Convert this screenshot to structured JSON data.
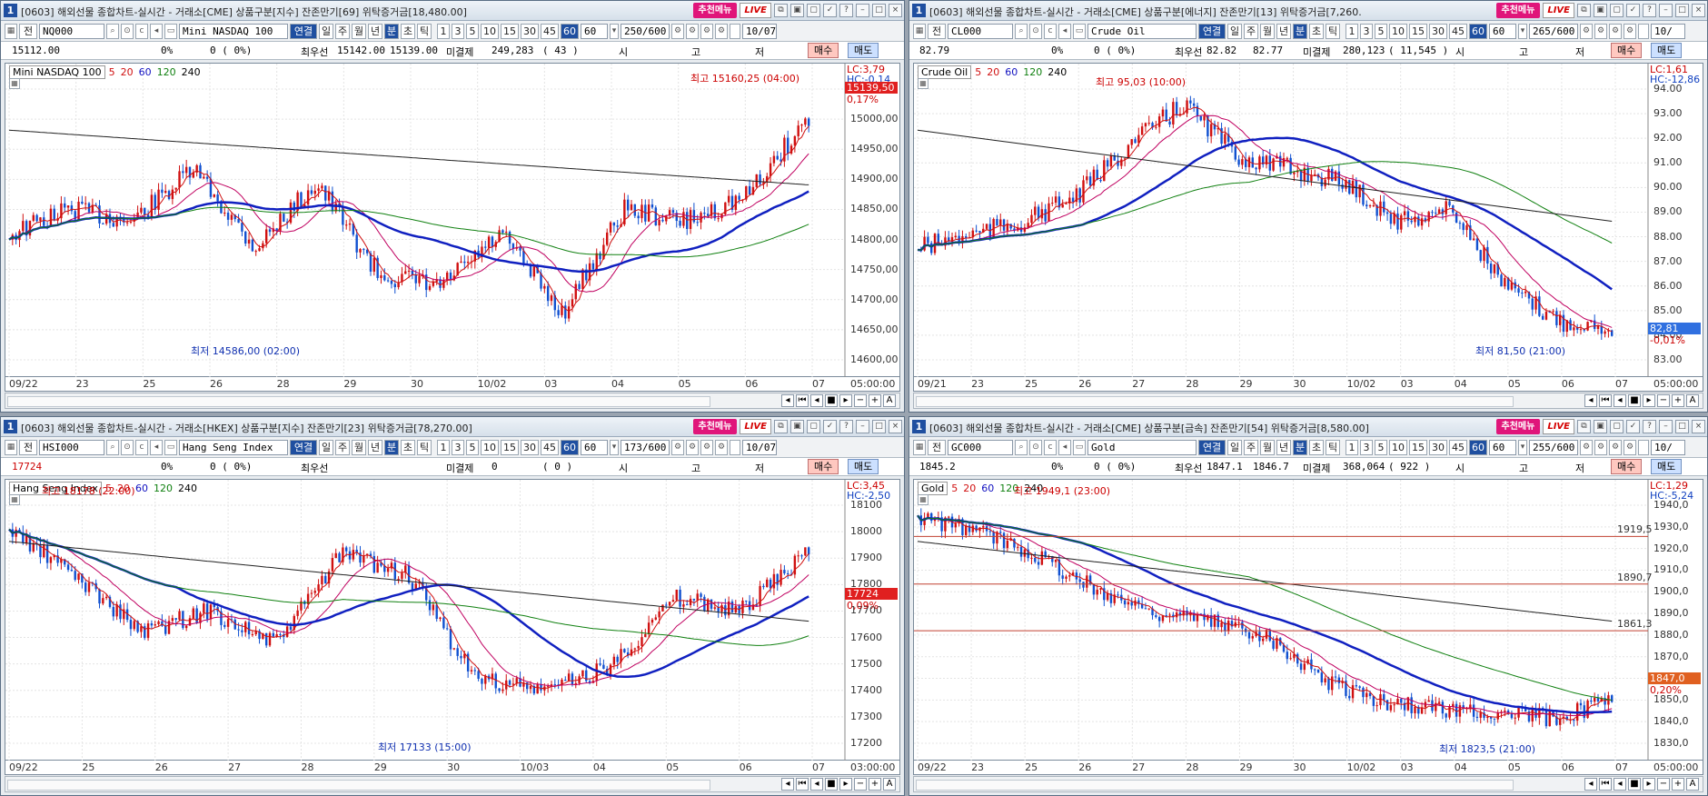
{
  "panels": [
    {
      "title": "[0603] 해외선물 종합차트-실시간 - 거래소[CME] 상품구분[지수] 잔존만기[69] 위탁증거금[18,480.00]",
      "code": "NQ000",
      "name": "Mini NASDAQ 100",
      "count": "250/600",
      "date": "10/07",
      "info": {
        "price": "15112.00",
        "rate": "0%",
        "diff": "0 (   0%)",
        "best_label": "최우선",
        "best_bid": "15142.00",
        "best_ask": "15139.00",
        "oi_label": "미결제",
        "oi": "249,283",
        "oi_chg": "(   43   )",
        "open": "시",
        "high": "고",
        "low": "저"
      },
      "legend": "Mini NASDAQ 100",
      "ylabels": [
        "15050,00",
        "15000,00",
        "14950,00",
        "14900,00",
        "14850,00",
        "14800,00",
        "14750,00",
        "14700,00",
        "14650,00",
        "14600,00"
      ],
      "lc": "LC:3,79",
      "hc": "HC:-0,14",
      "price_tag": "15139,50",
      "pct": "0,17%",
      "hi_label": "최고 15160,25 (04:00)",
      "lo_label": "최저 14586,00 (02:00)",
      "xlabels": [
        "09/22",
        "23",
        "25",
        "26",
        "28",
        "29",
        "30",
        "10/02",
        "03",
        "04",
        "05",
        "06",
        "07"
      ],
      "timelabel": "05:00:00"
    },
    {
      "title": "[0603] 해외선물 종합차트-실시간 - 거래소[CME] 상품구분[에너지] 잔존만기[13] 위탁증거금[7,260.",
      "code": "CL000",
      "name": "Crude Oil",
      "count": "265/600",
      "date": "10/",
      "info": {
        "price": "82.79",
        "rate": "0%",
        "diff": "0 (   0%)",
        "best_label": "최우선",
        "best_bid": "82.82",
        "best_ask": "82.77",
        "oi_label": "미결제",
        "oi": "280,123",
        "oi_chg": "( 11,545 )",
        "open": "시",
        "high": "고",
        "low": "저"
      },
      "legend": "Crude Oil",
      "ylabels": [
        "94.00",
        "93.00",
        "92.00",
        "91.00",
        "90.00",
        "89.00",
        "88.00",
        "87.00",
        "86.00",
        "85.00",
        "84.00",
        "83.00"
      ],
      "lc": "LC:1,61",
      "hc": "HC:-12,86",
      "price_tag": "82,81",
      "pct": "-0,01%",
      "hi_label": "최고 95,03 (10:00)",
      "lo_label": "최저 81,50 (21:00)",
      "xlabels": [
        "09/21",
        "23",
        "25",
        "26",
        "27",
        "28",
        "29",
        "30",
        "10/02",
        "03",
        "04",
        "05",
        "06",
        "07"
      ],
      "timelabel": "05:00:00"
    },
    {
      "title": "[0603] 해외선물 종합차트-실시간 - 거래소[HKEX] 상품구분[지수] 잔존만기[23] 위탁증거금[78,270.00]",
      "code": "HSI000",
      "name": "Hang Seng Index",
      "count": "173/600",
      "date": "10/07",
      "info": {
        "price": "17724",
        "rate": "0%",
        "diff": "0 (   0%)",
        "best_label": "최우선",
        "best_bid": "",
        "best_ask": "",
        "oi_label": "미결제",
        "oi": "0",
        "oi_chg": "(   0   )",
        "open": "시",
        "high": "고",
        "low": "저"
      },
      "legend": "Hang Seng Index",
      "ylabels": [
        "18100",
        "18000",
        "17900",
        "17800",
        "17700",
        "17600",
        "17500",
        "17400",
        "17300",
        "17200"
      ],
      "lc": "LC:3,45",
      "hc": "HC:-2,50",
      "price_tag": "17724",
      "pct": "0,09%",
      "hi_label": "최고 18178 (22:00)",
      "lo_label": "최저 17133 (15:00)",
      "xlabels": [
        "09/22",
        "25",
        "26",
        "27",
        "28",
        "29",
        "30",
        "10/03",
        "04",
        "05",
        "06",
        "07"
      ],
      "timelabel": "03:00:00"
    },
    {
      "title": "[0603] 해외선물 종합차트-실시간 - 거래소[CME] 상품구분[금속] 잔존만기[54] 위탁증거금[8,580.00]",
      "code": "GC000",
      "name": "Gold",
      "count": "255/600",
      "date": "10/",
      "info": {
        "price": "1845.2",
        "rate": "0%",
        "diff": "0 (   0%)",
        "best_label": "최우선",
        "best_bid": "1847.1",
        "best_ask": "1846.7",
        "oi_label": "미결제",
        "oi": "368,064",
        "oi_chg": "(  922  )",
        "open": "시",
        "high": "고",
        "low": "저"
      },
      "legend": "Gold",
      "ylabels": [
        "1940,0",
        "1930,0",
        "1920,0",
        "1910,0",
        "1900,0",
        "1890,0",
        "1880,0",
        "1870,0",
        "1860,0",
        "1850,0",
        "1840,0",
        "1830,0"
      ],
      "lc": "LC:1,29",
      "hc": "HC:-5,24",
      "price_tag": "1847,0",
      "pct": "0,20%",
      "hi_label": "최고 1949,1 (23:00)",
      "lo_label": "최저 1823,5 (21:00)",
      "levels": [
        "1919,5",
        "1890,7",
        "1861,3"
      ],
      "xlabels": [
        "09/22",
        "23",
        "25",
        "26",
        "27",
        "28",
        "29",
        "30",
        "10/02",
        "03",
        "04",
        "05",
        "06",
        "07"
      ],
      "timelabel": "05:00:00"
    }
  ],
  "common": {
    "jeon": "전",
    "btn_rec": "추천메뉴",
    "btn_live": "LIVE",
    "btn_link": "연결",
    "period": [
      "일",
      "주",
      "월",
      "년",
      "분",
      "초",
      "틱"
    ],
    "nums": [
      "1",
      "3",
      "5",
      "10",
      "15",
      "30",
      "45",
      "60"
    ],
    "sel": "60",
    "buy": "매수",
    "sell": "매도",
    "ma": [
      "5",
      "20",
      "60",
      "120",
      "240"
    ],
    "ma_colors": [
      "#d01010",
      "#d01010",
      "#1010c0",
      "#108010",
      "#000000"
    ]
  }
}
